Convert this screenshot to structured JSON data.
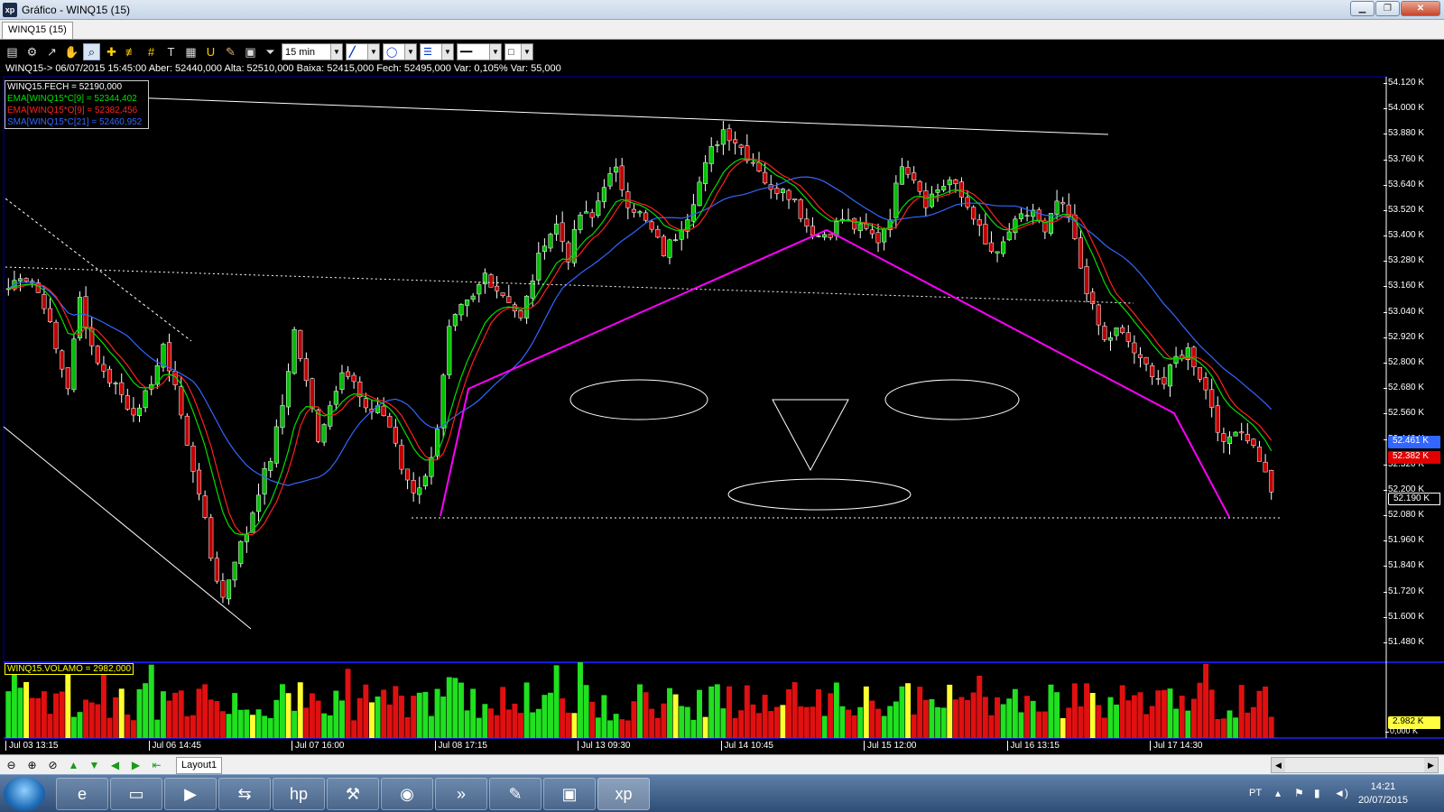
{
  "window": {
    "title": "Gráfico - WINQ15 (15)",
    "app_icon": "xp",
    "controls": [
      "minimize",
      "maximize",
      "close"
    ]
  },
  "chart_tab": "WINQ15 (15)",
  "toolbar": {
    "timeframe": "15 min",
    "icons": [
      "chart-type-icon",
      "settings-icon",
      "cursor-icon",
      "hand-icon",
      "zoom-icon",
      "crosshair-icon",
      "horizontal-line-icon",
      "grid-icon",
      "text-icon",
      "calculator-icon",
      "magnet-icon",
      "brush-icon",
      "lock-icon",
      "filter-icon"
    ]
  },
  "info_line": "WINQ15-> 06/07/2015 15:45:00 Aber: 52440,000 Alta: 52510,000 Baixa: 52415,000 Fech: 52495,000 Var: 0,105% Var: 55,000",
  "legend": [
    {
      "text": "WINQ15.FECH = 52190,000",
      "color": "#ffffff"
    },
    {
      "text": "EMA[WINQ15*C[9] = 52344,402",
      "color": "#00e000"
    },
    {
      "text": "EMA[WINQ15*O[9] = 52382,456",
      "color": "#ff2020"
    },
    {
      "text": "SMA[WINQ15*C[21] = 52460,952",
      "color": "#3366ff"
    }
  ],
  "volume_legend": "WINQ15.VOLAMO = 2982,000",
  "price_labels": [
    {
      "text": "52.461 K",
      "color": "#3366ff",
      "value": 52461
    },
    {
      "text": "52.382 K",
      "color": "#e00000",
      "value": 52382
    },
    {
      "text": "52.190 K",
      "color": "#000000",
      "value": 52190
    }
  ],
  "volume_label": "2.982 K",
  "volume_zero": "0,000 K",
  "chart_data": {
    "type": "candlestick",
    "symbol": "WINQ15",
    "timeframe": "15 min",
    "y_ticks": [
      "54.120 K",
      "54.000 K",
      "53.880 K",
      "53.760 K",
      "53.640 K",
      "53.520 K",
      "53.400 K",
      "53.280 K",
      "53.160 K",
      "53.040 K",
      "52.920 K",
      "52.800 K",
      "52.680 K",
      "52.560 K",
      "52.440 K",
      "52.320 K",
      "52.200 K",
      "52.080 K",
      "51.960 K",
      "51.840 K",
      "51.720 K",
      "51.600 K",
      "51.480 K"
    ],
    "ylim": [
      51480,
      54120
    ],
    "x_ticks": [
      "Jul 03 13:15",
      "Jul 06 14:45",
      "Jul 07 16:00",
      "Jul 08 17:15",
      "Jul 13 09:30",
      "Jul 14 10:45",
      "Jul 15 12:00",
      "Jul 16 13:15",
      "Jul 17 14:30"
    ],
    "last_close": 52190,
    "series": [
      {
        "name": "WINQ15.FECH",
        "color": "#ffffff",
        "last": 52190
      },
      {
        "name": "EMA[WINQ15*C[9]",
        "color": "#00e000",
        "last": 52344.402
      },
      {
        "name": "EMA[WINQ15*O[9]",
        "color": "#ff2020",
        "last": 52382.456
      },
      {
        "name": "SMA[WINQ15*C[21]",
        "color": "#3366ff",
        "last": 52460.952
      }
    ],
    "close_path": [
      [
        0,
        53150
      ],
      [
        2,
        53220
      ],
      [
        4,
        53180
      ],
      [
        6,
        53080
      ],
      [
        8,
        52860
      ],
      [
        10,
        52690
      ],
      [
        12,
        53100
      ],
      [
        14,
        52880
      ],
      [
        16,
        52750
      ],
      [
        18,
        52700
      ],
      [
        20,
        52600
      ],
      [
        22,
        52560
      ],
      [
        24,
        52720
      ],
      [
        26,
        52860
      ],
      [
        28,
        52700
      ],
      [
        30,
        52400
      ],
      [
        32,
        52200
      ],
      [
        34,
        51880
      ],
      [
        36,
        51690
      ],
      [
        38,
        51880
      ],
      [
        40,
        52000
      ],
      [
        42,
        52200
      ],
      [
        44,
        52350
      ],
      [
        46,
        52600
      ],
      [
        48,
        52950
      ],
      [
        50,
        52700
      ],
      [
        52,
        52450
      ],
      [
        54,
        52600
      ],
      [
        56,
        52780
      ],
      [
        58,
        52700
      ],
      [
        60,
        52560
      ],
      [
        62,
        52600
      ],
      [
        64,
        52500
      ],
      [
        66,
        52300
      ],
      [
        68,
        52200
      ],
      [
        70,
        52250
      ],
      [
        72,
        52500
      ],
      [
        74,
        52950
      ],
      [
        76,
        53050
      ],
      [
        78,
        53100
      ],
      [
        80,
        53220
      ],
      [
        82,
        53150
      ],
      [
        84,
        53100
      ],
      [
        86,
        53000
      ],
      [
        88,
        53200
      ],
      [
        90,
        53380
      ],
      [
        92,
        53450
      ],
      [
        94,
        53300
      ],
      [
        96,
        53500
      ],
      [
        98,
        53480
      ],
      [
        100,
        53650
      ],
      [
        102,
        53700
      ],
      [
        104,
        53560
      ],
      [
        106,
        53500
      ],
      [
        108,
        53420
      ],
      [
        110,
        53320
      ],
      [
        112,
        53400
      ],
      [
        114,
        53500
      ],
      [
        116,
        53650
      ],
      [
        118,
        53800
      ],
      [
        120,
        53900
      ],
      [
        122,
        53850
      ],
      [
        124,
        53780
      ],
      [
        126,
        53720
      ],
      [
        128,
        53600
      ],
      [
        130,
        53640
      ],
      [
        132,
        53560
      ],
      [
        134,
        53450
      ],
      [
        136,
        53400
      ],
      [
        138,
        53420
      ],
      [
        140,
        53480
      ],
      [
        142,
        53440
      ],
      [
        144,
        53420
      ],
      [
        146,
        53380
      ],
      [
        148,
        53500
      ],
      [
        150,
        53750
      ],
      [
        152,
        53680
      ],
      [
        154,
        53560
      ],
      [
        156,
        53620
      ],
      [
        158,
        53660
      ],
      [
        160,
        53580
      ],
      [
        162,
        53500
      ],
      [
        164,
        53350
      ],
      [
        166,
        53300
      ],
      [
        168,
        53420
      ],
      [
        170,
        53480
      ],
      [
        172,
        53520
      ],
      [
        174,
        53400
      ],
      [
        176,
        53560
      ],
      [
        178,
        53480
      ],
      [
        180,
        53250
      ],
      [
        182,
        53050
      ],
      [
        184,
        52900
      ],
      [
        186,
        52950
      ],
      [
        188,
        52900
      ],
      [
        190,
        52800
      ],
      [
        192,
        52760
      ],
      [
        194,
        52700
      ],
      [
        196,
        52820
      ],
      [
        198,
        52860
      ],
      [
        200,
        52740
      ],
      [
        202,
        52600
      ],
      [
        204,
        52400
      ],
      [
        206,
        52500
      ],
      [
        208,
        52450
      ],
      [
        210,
        52350
      ],
      [
        212,
        52190
      ]
    ],
    "volume_series": {
      "name": "WINQ15.VOLAMO",
      "last": 2982
    },
    "annotations": {
      "lines": "trendlines (white), support/neckline (dotted), magenta head-and-shoulders outline",
      "shapes": "two ellipses, an inverted triangle and a lower ellipse drawn as a face"
    }
  },
  "bottom": {
    "layout_tab": "Layout1",
    "icons": [
      "zoom-out-icon",
      "zoom-in-icon",
      "zoom-reset-icon",
      "arrow-up-icon",
      "arrow-down-icon",
      "arrow-left-icon",
      "arrow-right-icon",
      "arrow-start-icon"
    ]
  },
  "taskbar": {
    "apps": [
      "ie-icon",
      "explorer-icon",
      "media-player-icon",
      "network-icon",
      "hp-icon",
      "tools-icon",
      "chrome-icon",
      "app-icon",
      "paint-icon",
      "photos-icon",
      "xp-icon"
    ],
    "lang": "PT",
    "time": "14:21",
    "date": "20/07/2015"
  }
}
